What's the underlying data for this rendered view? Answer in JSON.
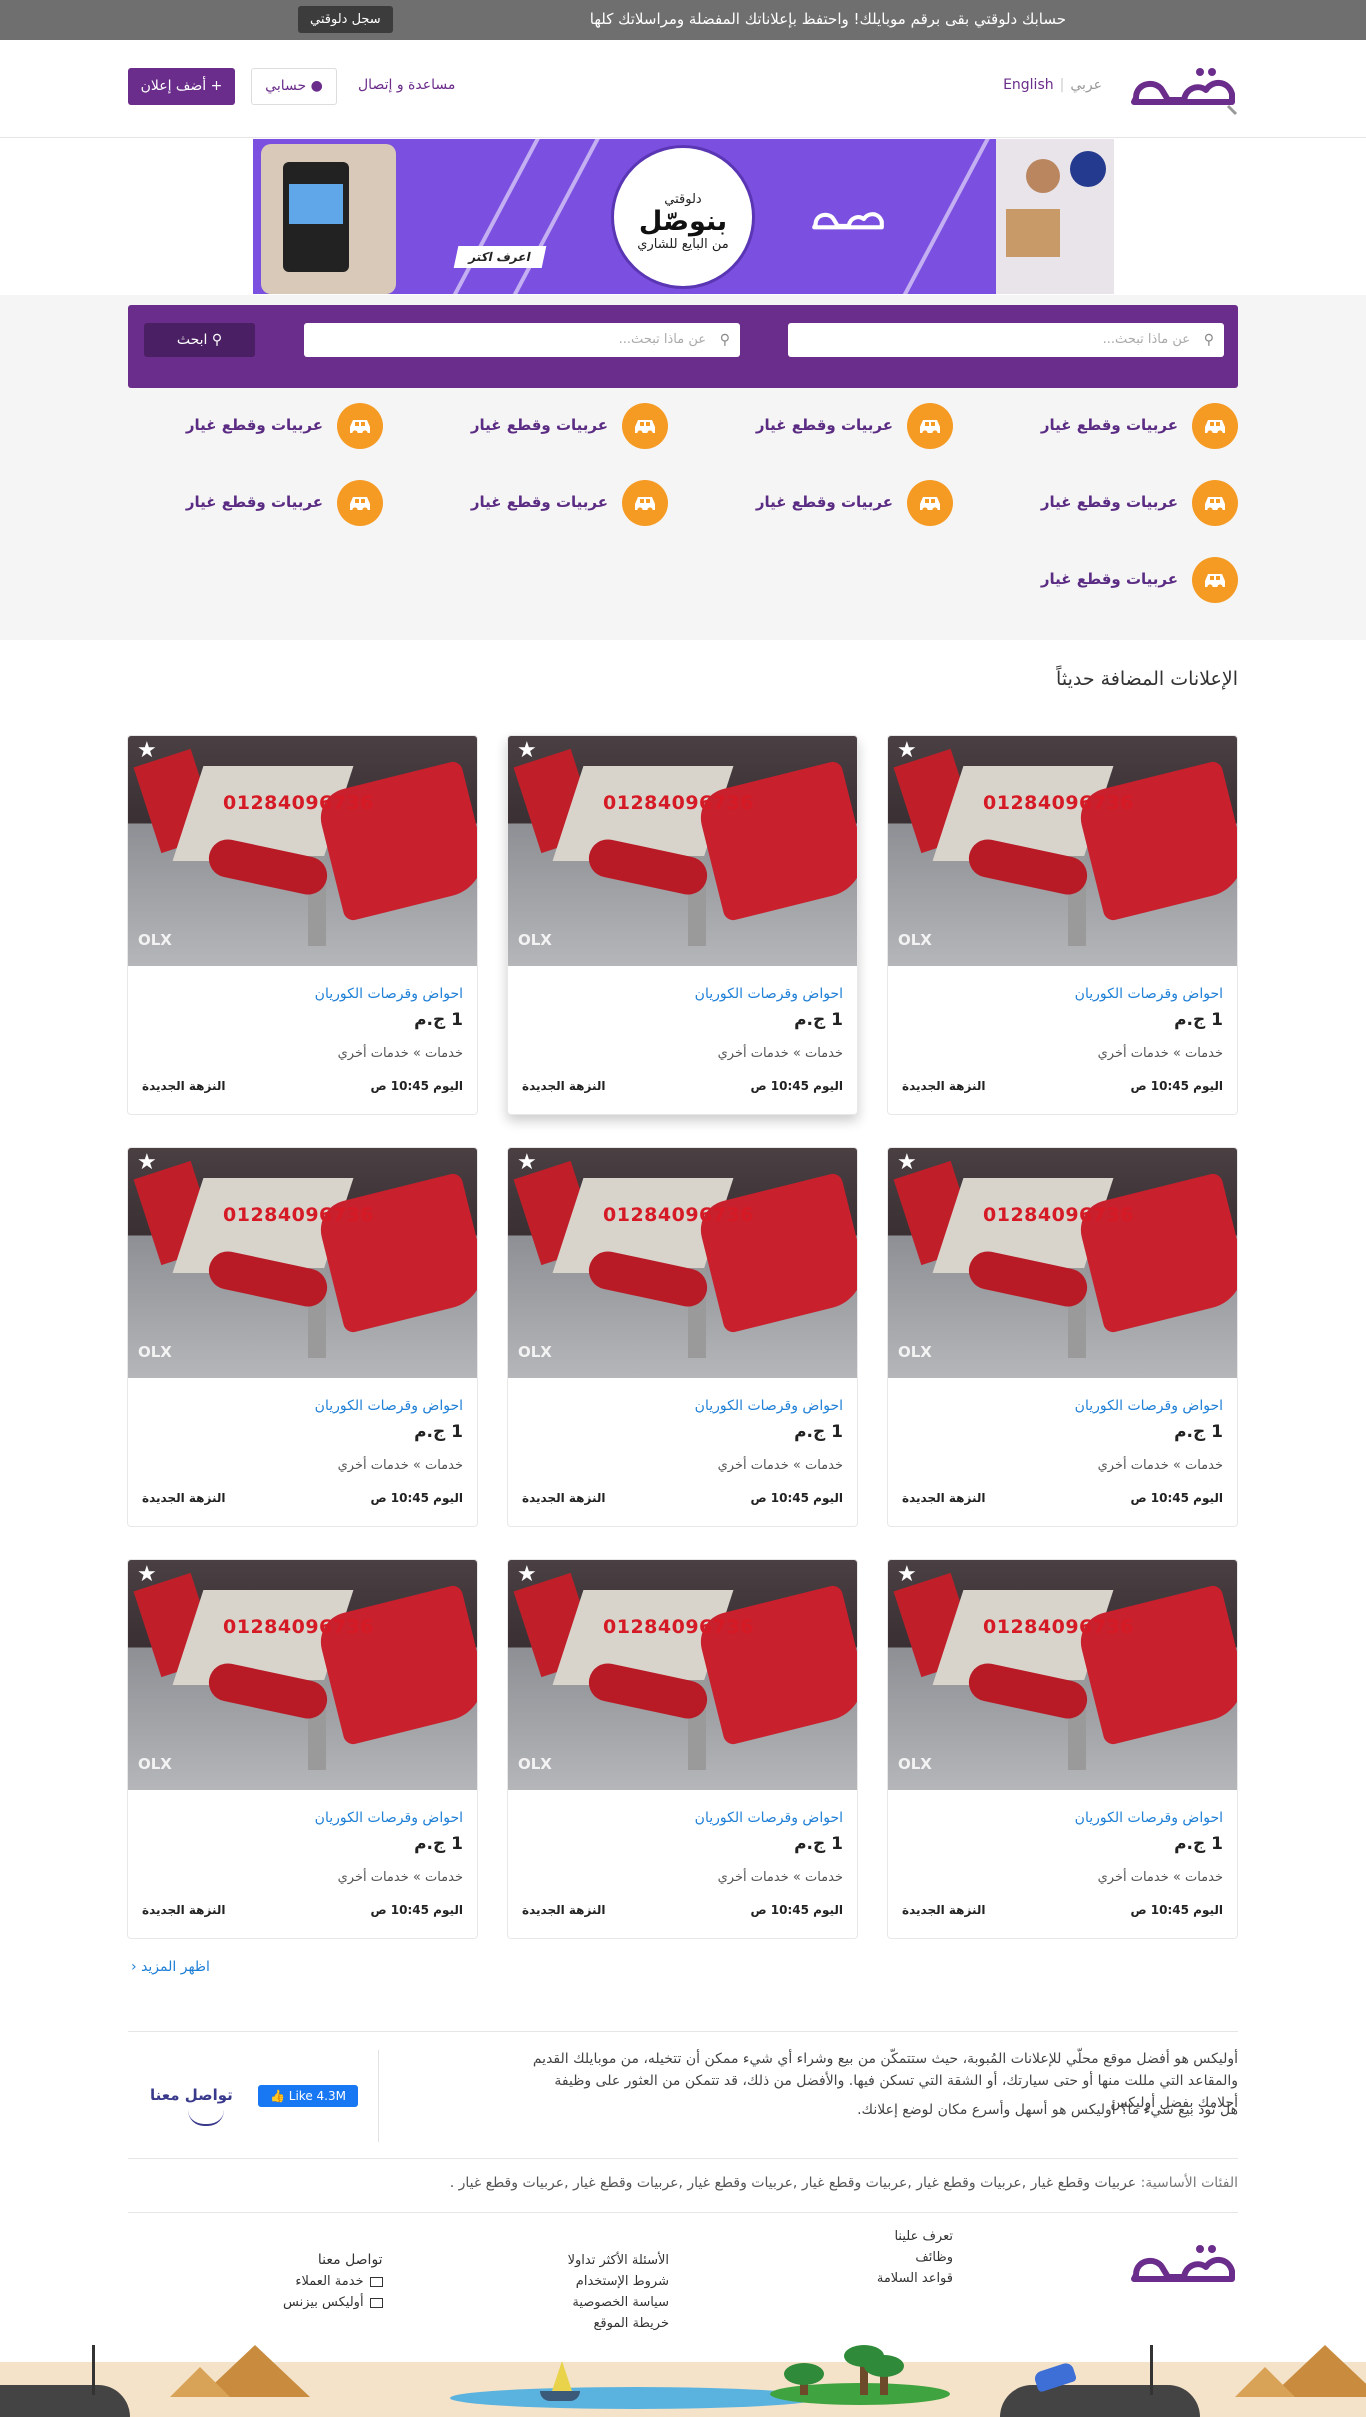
{
  "topbar": {
    "message": "حسابك دلوقتي بقى برقم موبايلك! واحتفظ بإعلاناتك المفضلة ومراسلاتك كلها",
    "register_label": "سجل دلوقتي"
  },
  "header": {
    "lang_ar": "عربي",
    "lang_en": "English",
    "add_ad_label": "أضف إعلان",
    "account_label": "حسابي",
    "help_label": "مساعدة و إتصال"
  },
  "banner": {
    "line1": "دلوقتي",
    "line2": "بنوصّل",
    "line3": "من البايع للشاري",
    "cta": "اعرف اكتر"
  },
  "search": {
    "placeholder1": "عن ماذا تبحث...",
    "placeholder2": "عن ماذا تبحث...",
    "button_label": "ابحث"
  },
  "categories": [
    {
      "label": "عربيات وقطع غيار",
      "icon": "car-icon"
    },
    {
      "label": "عربيات وقطع غيار",
      "icon": "car-icon"
    },
    {
      "label": "عربيات وقطع غيار",
      "icon": "car-icon"
    },
    {
      "label": "عربيات وقطع غيار",
      "icon": "car-icon"
    },
    {
      "label": "عربيات وقطع غيار",
      "icon": "car-icon"
    },
    {
      "label": "عربيات وقطع غيار",
      "icon": "car-icon"
    },
    {
      "label": "عربيات وقطع غيار",
      "icon": "car-icon"
    },
    {
      "label": "عربيات وقطع غيار",
      "icon": "car-icon"
    },
    {
      "label": "عربيات وقطع غيار",
      "icon": "car-icon"
    }
  ],
  "recent": {
    "title": "الإعلانات المضافة حديثاً",
    "ads": [
      {
        "title": "احواض وقرصات الكوريان",
        "price": "1 ج.م",
        "category": "خدمات » خدمات أخري",
        "date": "اليوم 10:45 ص",
        "location": "النزهة الجديدة",
        "watermark": "01284096736",
        "source_logo": "OLX"
      },
      {
        "title": "احواض وقرصات الكوريان",
        "price": "1 ج.م",
        "category": "خدمات » خدمات أخري",
        "date": "اليوم 10:45 ص",
        "location": "النزهة الجديدة",
        "watermark": "01284096736",
        "source_logo": "OLX"
      },
      {
        "title": "احواض وقرصات الكوريان",
        "price": "1 ج.م",
        "category": "خدمات » خدمات أخري",
        "date": "اليوم 10:45 ص",
        "location": "النزهة الجديدة",
        "watermark": "01284096736",
        "source_logo": "OLX"
      },
      {
        "title": "احواض وقرصات الكوريان",
        "price": "1 ج.م",
        "category": "خدمات » خدمات أخري",
        "date": "اليوم 10:45 ص",
        "location": "النزهة الجديدة",
        "watermark": "01284096736",
        "source_logo": "OLX"
      },
      {
        "title": "احواض وقرصات الكوريان",
        "price": "1 ج.م",
        "category": "خدمات » خدمات أخري",
        "date": "اليوم 10:45 ص",
        "location": "النزهة الجديدة",
        "watermark": "01284096736",
        "source_logo": "OLX"
      },
      {
        "title": "احواض وقرصات الكوريان",
        "price": "1 ج.م",
        "category": "خدمات » خدمات أخري",
        "date": "اليوم 10:45 ص",
        "location": "النزهة الجديدة",
        "watermark": "01284096736",
        "source_logo": "OLX"
      },
      {
        "title": "احواض وقرصات الكوريان",
        "price": "1 ج.م",
        "category": "خدمات » خدمات أخري",
        "date": "اليوم 10:45 ص",
        "location": "النزهة الجديدة",
        "watermark": "01284096736",
        "source_logo": "OLX"
      },
      {
        "title": "احواض وقرصات الكوريان",
        "price": "1 ج.م",
        "category": "خدمات » خدمات أخري",
        "date": "اليوم 10:45 ص",
        "location": "النزهة الجديدة",
        "watermark": "01284096736",
        "source_logo": "OLX"
      },
      {
        "title": "احواض وقرصات الكوريان",
        "price": "1 ج.م",
        "category": "خدمات » خدمات أخري",
        "date": "اليوم 10:45 ص",
        "location": "النزهة الجديدة",
        "watermark": "01284096736",
        "source_logo": "OLX"
      }
    ],
    "more_label": "اظهر المزيد"
  },
  "about": {
    "paragraph1": "أوليكس هو أفضل موقع محلّي للإعلانات المُبوبة، حيث ستتمكّن من بيع وشراء أي شيء ممكن أن تتخيله، من موبايلك القديم والمقاعد التي مللت منها أو حتى سيارتك، أو الشقة التي تسكن فيها. والأفضل من ذلك، قد تتمكن من العثور على وظيفة أحلامك بفضل أوليكس",
    "paragraph2": "هل تود بيع شيء ما؟ أوليكس هو أسهل وأسرع مكان لوضع إعلانك.",
    "fb_label": "Like 4.3M",
    "contact_label": "تواصل معنا"
  },
  "main_categories": {
    "label": "الفئات الأساسية:",
    "list": "عربيات وقطع غيار ,عربيات وقطع غيار ,عربيات وقطع غيار ,عربيات وقطع غيار ,عربيات وقطع غيار ,عربيات وقطع غيار ."
  },
  "footer": {
    "col1": [
      "تعرف علينا",
      "وظائف",
      "قواعد السلامة"
    ],
    "col2": [
      "الأسئلة الأكثر تداولا",
      "شروط الإستخدام",
      "سياسة الخصوصية",
      "خريطة الموقع"
    ],
    "col3_title": "تواصل معنا",
    "col3": [
      "خدمة العملاء",
      "أوليكس بيزنس"
    ]
  },
  "colors": {
    "brand": "#6b2d8b",
    "accent": "#f59a23",
    "link": "#1e7fd6"
  }
}
